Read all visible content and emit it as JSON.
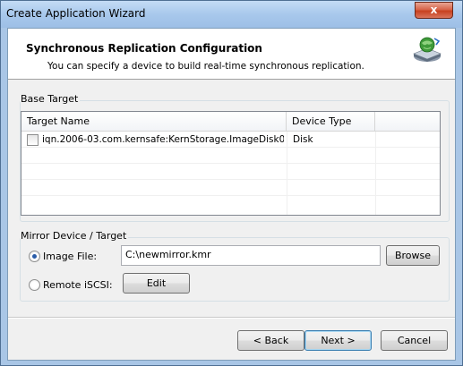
{
  "window": {
    "title": "Create Application Wizard",
    "close_glyph": "x"
  },
  "header": {
    "title": "Synchronous Replication Configuration",
    "subtitle": "You can specify a device to build real-time synchronous replication.",
    "icon": "network-disk-icon"
  },
  "base_target": {
    "group_label": "Base Target",
    "columns": [
      "Target Name",
      "Device Type"
    ],
    "rows": [
      {
        "name": "iqn.2006-03.com.kernsafe:KernStorage.ImageDisk0",
        "type": "Disk",
        "checked": false
      }
    ]
  },
  "mirror": {
    "group_label": "Mirror Device / Target",
    "image_file": {
      "label": "Image File:",
      "selected": true,
      "value": "C:\\newmirror.kmr",
      "browse_label": "Browse"
    },
    "remote_iscsi": {
      "label": "Remote iSCSI:",
      "selected": false,
      "edit_label": "Edit"
    }
  },
  "footer": {
    "back_label": "< Back",
    "next_label": "Next >",
    "cancel_label": "Cancel"
  },
  "colors": {
    "title_bar": "#a8c8ec",
    "close_button": "#c7411f",
    "client_bg": "#f0f0f0",
    "radio_selected": "#2a5ca8"
  }
}
